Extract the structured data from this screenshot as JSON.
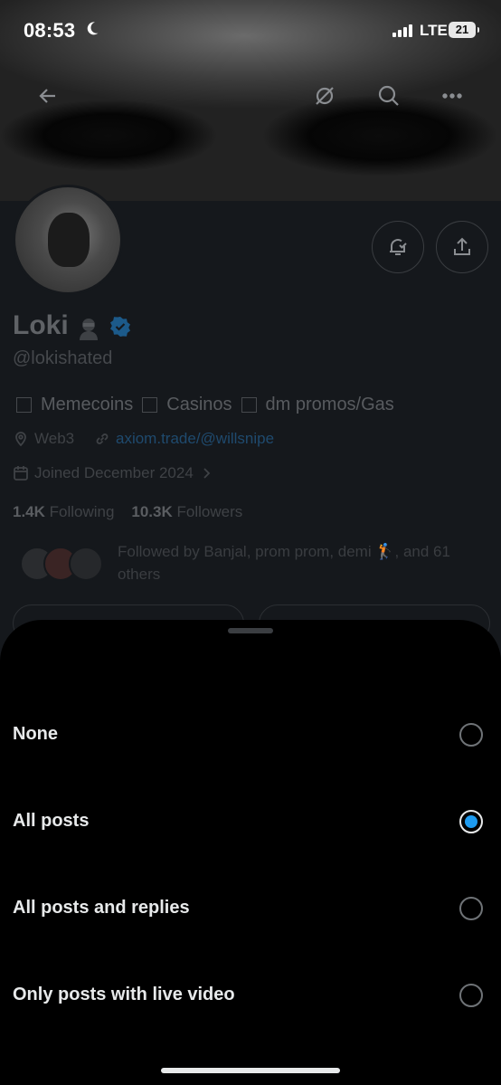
{
  "status_bar": {
    "time": "08:53",
    "network": "LTE",
    "battery": "21"
  },
  "header_icons": [
    "back-arrow-icon",
    "no-signal-icon",
    "search-icon",
    "more-icon"
  ],
  "profile": {
    "name": "Loki",
    "handle": "@lokishated",
    "bio": [
      "Memecoins",
      "Casinos",
      "dm promos/Gas"
    ],
    "location": "Web3",
    "link": "axiom.trade/@willsnipe",
    "joined": "Joined December 2024",
    "following_count": "1.4K",
    "following_label": "Following",
    "followers_count": "10.3K",
    "followers_label": "Followers",
    "followed_by": "Followed by Banjal, prom prom, demi 🏌️, and 61 others"
  },
  "notification_sheet": {
    "options": [
      {
        "label": "None",
        "selected": false
      },
      {
        "label": "All posts",
        "selected": true
      },
      {
        "label": "All posts and replies",
        "selected": false
      },
      {
        "label": "Only posts with live video",
        "selected": false
      }
    ],
    "accent": "#1d9bf0"
  }
}
